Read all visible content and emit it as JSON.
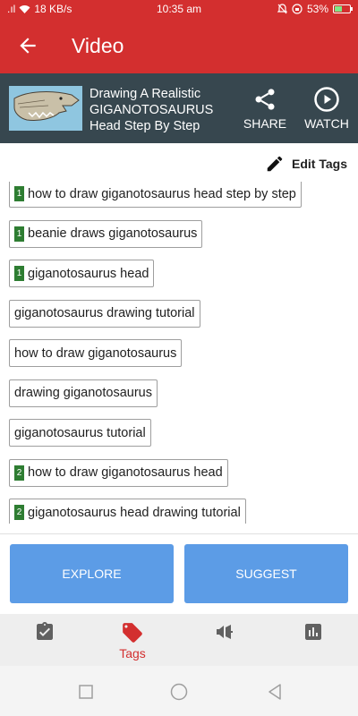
{
  "status": {
    "signal": ".ıl",
    "speed": "18 KB/s",
    "time": "10:35 am",
    "battery": "53%",
    "battery_level": 0.53
  },
  "appbar": {
    "title": "Video"
  },
  "video": {
    "title_line1": "Drawing A Realistic",
    "title_line2": "GIGANOTOSAURUS",
    "title_line3": "Head Step By Step",
    "share_label": "SHARE",
    "watch_label": "WATCH"
  },
  "edit_tags_label": "Edit Tags",
  "tags": [
    {
      "rank": "1",
      "text": "how to draw giganotosaurus head step by step"
    },
    {
      "rank": "1",
      "text": "beanie draws giganotosaurus"
    },
    {
      "rank": "1",
      "text": "giganotosaurus head"
    },
    {
      "rank": "",
      "text": "giganotosaurus drawing tutorial"
    },
    {
      "rank": "",
      "text": "how to draw giganotosaurus"
    },
    {
      "rank": "",
      "text": "drawing giganotosaurus"
    },
    {
      "rank": "",
      "text": "giganotosaurus tutorial"
    },
    {
      "rank": "2",
      "text": "how to draw giganotosaurus head"
    },
    {
      "rank": "2",
      "text": "giganotosaurus head drawing tutorial"
    }
  ],
  "buttons": {
    "explore": "EXPLORE",
    "suggest": "SUGGEST"
  },
  "nav": {
    "tags_label": "Tags"
  },
  "colors": {
    "primary": "#d32f2f",
    "header": "#37474f",
    "button": "#5c9ce6",
    "rank_badge": "#2e7d32"
  }
}
